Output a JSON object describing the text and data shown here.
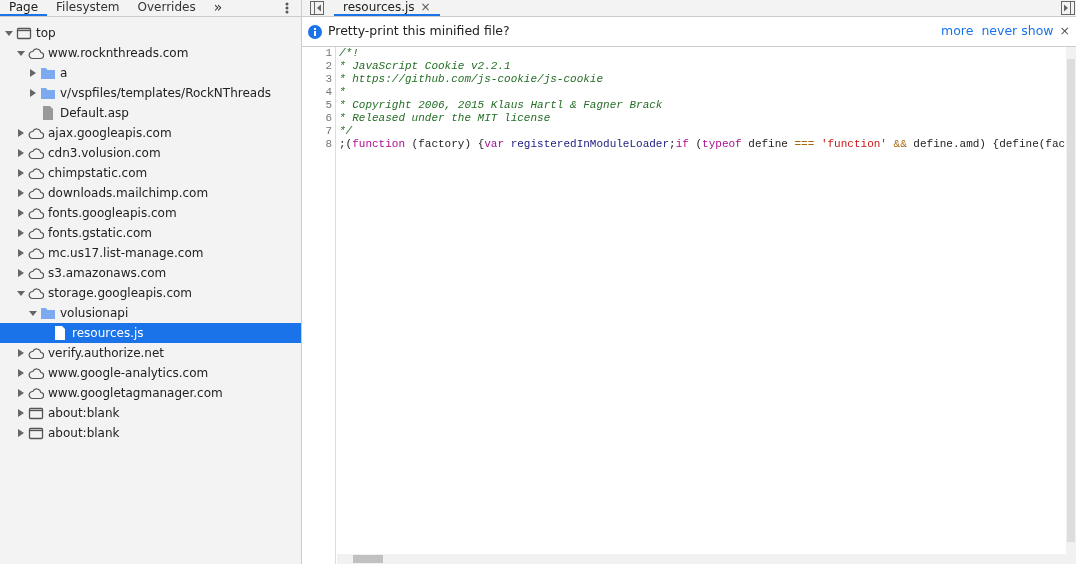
{
  "navigator": {
    "tabs": [
      {
        "label": "Page",
        "selected": true
      },
      {
        "label": "Filesystem",
        "selected": false
      },
      {
        "label": "Overrides",
        "selected": false
      }
    ],
    "more_tabs": "»",
    "tree": [
      {
        "kind": "frame",
        "label": "top",
        "expanded": true,
        "selected": false,
        "children": [
          {
            "kind": "domain",
            "label": "www.rocknthreads.com",
            "expanded": true,
            "selected": false,
            "children": [
              {
                "kind": "folder",
                "label": "a",
                "expanded": false,
                "selected": false
              },
              {
                "kind": "folder",
                "label": "v/vspfiles/templates/RockNThreads",
                "expanded": false,
                "selected": false
              },
              {
                "kind": "file",
                "label": "Default.asp",
                "selected": false
              }
            ]
          },
          {
            "kind": "domain",
            "label": "ajax.googleapis.com",
            "expanded": false,
            "selected": false
          },
          {
            "kind": "domain",
            "label": "cdn3.volusion.com",
            "expanded": false,
            "selected": false
          },
          {
            "kind": "domain",
            "label": "chimpstatic.com",
            "expanded": false,
            "selected": false
          },
          {
            "kind": "domain",
            "label": "downloads.mailchimp.com",
            "expanded": false,
            "selected": false
          },
          {
            "kind": "domain",
            "label": "fonts.googleapis.com",
            "expanded": false,
            "selected": false
          },
          {
            "kind": "domain",
            "label": "fonts.gstatic.com",
            "expanded": false,
            "selected": false
          },
          {
            "kind": "domain",
            "label": "mc.us17.list-manage.com",
            "expanded": false,
            "selected": false
          },
          {
            "kind": "domain",
            "label": "s3.amazonaws.com",
            "expanded": false,
            "selected": false
          },
          {
            "kind": "domain",
            "label": "storage.googleapis.com",
            "expanded": true,
            "selected": false,
            "children": [
              {
                "kind": "folder",
                "label": "volusionapi",
                "expanded": true,
                "selected": false,
                "children": [
                  {
                    "kind": "file",
                    "label": "resources.js",
                    "selected": true
                  }
                ]
              }
            ]
          },
          {
            "kind": "domain",
            "label": "verify.authorize.net",
            "expanded": false,
            "selected": false
          },
          {
            "kind": "domain",
            "label": "www.google-analytics.com",
            "expanded": false,
            "selected": false
          },
          {
            "kind": "domain",
            "label": "www.googletagmanager.com",
            "expanded": false,
            "selected": false
          },
          {
            "kind": "frame",
            "label": "about:blank",
            "expanded": false,
            "selected": false
          },
          {
            "kind": "frame",
            "label": "about:blank",
            "expanded": false,
            "selected": false
          }
        ]
      }
    ]
  },
  "editor": {
    "tabs": [
      {
        "label": "resources.js",
        "selected": true,
        "close": "×"
      }
    ],
    "infobar": {
      "message": "Pretty-print this minified file?",
      "links": [
        "more",
        "never show"
      ],
      "close": "×"
    },
    "lines": [
      {
        "number": "1",
        "tokens": [
          {
            "kind": "comment",
            "text": "/*!"
          }
        ]
      },
      {
        "number": "2",
        "tokens": [
          {
            "kind": "comment",
            "text": "* JavaScript Cookie v2.2.1"
          }
        ]
      },
      {
        "number": "3",
        "tokens": [
          {
            "kind": "comment",
            "text": "* https://github.com/js-cookie/js-cookie"
          }
        ]
      },
      {
        "number": "4",
        "tokens": [
          {
            "kind": "comment",
            "text": "*"
          }
        ]
      },
      {
        "number": "5",
        "tokens": [
          {
            "kind": "comment",
            "text": "* Copyright 2006, 2015 Klaus Hartl & Fagner Brack"
          }
        ]
      },
      {
        "number": "6",
        "tokens": [
          {
            "kind": "comment",
            "text": "* Released under the MIT license"
          }
        ]
      },
      {
        "number": "7",
        "tokens": [
          {
            "kind": "comment",
            "text": "*/"
          }
        ]
      },
      {
        "number": "8",
        "tokens": [
          {
            "kind": "plain",
            "text": ";("
          },
          {
            "kind": "keyword",
            "text": "function"
          },
          {
            "kind": "plain",
            "text": " (factory) {"
          },
          {
            "kind": "keyword",
            "text": "var"
          },
          {
            "kind": "name",
            "text": " registeredInModuleLoader"
          },
          {
            "kind": "plain",
            "text": ";"
          },
          {
            "kind": "keyword",
            "text": "if"
          },
          {
            "kind": "plain",
            "text": " ("
          },
          {
            "kind": "keyword",
            "text": "typeof"
          },
          {
            "kind": "plain",
            "text": " define "
          },
          {
            "kind": "operator",
            "text": "=== "
          },
          {
            "kind": "string",
            "text": "'function'"
          },
          {
            "kind": "operator",
            "text": " &&"
          },
          {
            "kind": "plain",
            "text": " define.amd) {define(fac"
          }
        ]
      }
    ]
  }
}
